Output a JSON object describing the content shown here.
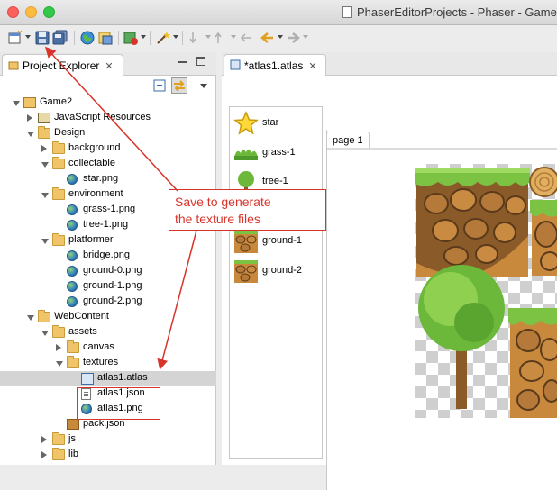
{
  "window": {
    "title": "PhaserEditorProjects - Phaser - Game",
    "controls": [
      "close",
      "minimize",
      "zoom"
    ]
  },
  "toolbar": {
    "icons": [
      "new-wizard-icon",
      "save-icon",
      "save-all-icon",
      "globe-icon",
      "export-icon",
      "run-icon",
      "wand-icon",
      "next-annotation-icon",
      "previous-annotation-icon",
      "back-arrow-icon",
      "forward-arrow-icon"
    ]
  },
  "project_explorer": {
    "tab_label": "Project Explorer",
    "tab_close": "✕",
    "tree": [
      {
        "label": "Game2",
        "depth": 0,
        "type": "project",
        "state": "open"
      },
      {
        "label": "JavaScript Resources",
        "depth": 1,
        "type": "jsres",
        "state": "closed"
      },
      {
        "label": "Design",
        "depth": 1,
        "type": "folder",
        "state": "open"
      },
      {
        "label": "background",
        "depth": 2,
        "type": "folder",
        "state": "closed"
      },
      {
        "label": "collectable",
        "depth": 2,
        "type": "folder",
        "state": "open"
      },
      {
        "label": "star.png",
        "depth": 3,
        "type": "image",
        "state": "none"
      },
      {
        "label": "environment",
        "depth": 2,
        "type": "folder",
        "state": "open"
      },
      {
        "label": "grass-1.png",
        "depth": 3,
        "type": "image",
        "state": "none"
      },
      {
        "label": "tree-1.png",
        "depth": 3,
        "type": "image",
        "state": "none"
      },
      {
        "label": "platformer",
        "depth": 2,
        "type": "folder",
        "state": "open"
      },
      {
        "label": "bridge.png",
        "depth": 3,
        "type": "image",
        "state": "none"
      },
      {
        "label": "ground-0.png",
        "depth": 3,
        "type": "image",
        "state": "none"
      },
      {
        "label": "ground-1.png",
        "depth": 3,
        "type": "image",
        "state": "none"
      },
      {
        "label": "ground-2.png",
        "depth": 3,
        "type": "image",
        "state": "none"
      },
      {
        "label": "WebContent",
        "depth": 1,
        "type": "folder",
        "state": "open"
      },
      {
        "label": "assets",
        "depth": 2,
        "type": "folder",
        "state": "open"
      },
      {
        "label": "canvas",
        "depth": 3,
        "type": "folder",
        "state": "closed"
      },
      {
        "label": "textures",
        "depth": 3,
        "type": "folder",
        "state": "open"
      },
      {
        "label": "atlas1.atlas",
        "depth": 4,
        "type": "atlas",
        "state": "none",
        "selected": true
      },
      {
        "label": "atlas1.json",
        "depth": 4,
        "type": "json",
        "state": "none"
      },
      {
        "label": "atlas1.png",
        "depth": 4,
        "type": "image",
        "state": "none"
      },
      {
        "label": "pack.json",
        "depth": 3,
        "type": "pack",
        "state": "none"
      },
      {
        "label": "js",
        "depth": 2,
        "type": "folder",
        "state": "closed"
      },
      {
        "label": "lib",
        "depth": 2,
        "type": "folder",
        "state": "closed"
      }
    ]
  },
  "editor": {
    "tab_label": "*atlas1.atlas",
    "tab_close": "✕",
    "frames": [
      {
        "label": "star",
        "icon": "star-icon"
      },
      {
        "label": "grass-1",
        "icon": "grass-icon"
      },
      {
        "label": "tree-1",
        "icon": "tree-icon"
      },
      {
        "label": "ground-0",
        "icon": "ground-icon"
      },
      {
        "label": "ground-1",
        "icon": "ground-icon"
      },
      {
        "label": "ground-2",
        "icon": "ground-icon"
      }
    ],
    "page_tab": "page 1"
  },
  "annotation": {
    "line1": "Save to generate",
    "line2": "the texture files",
    "color": "#d9342b"
  }
}
